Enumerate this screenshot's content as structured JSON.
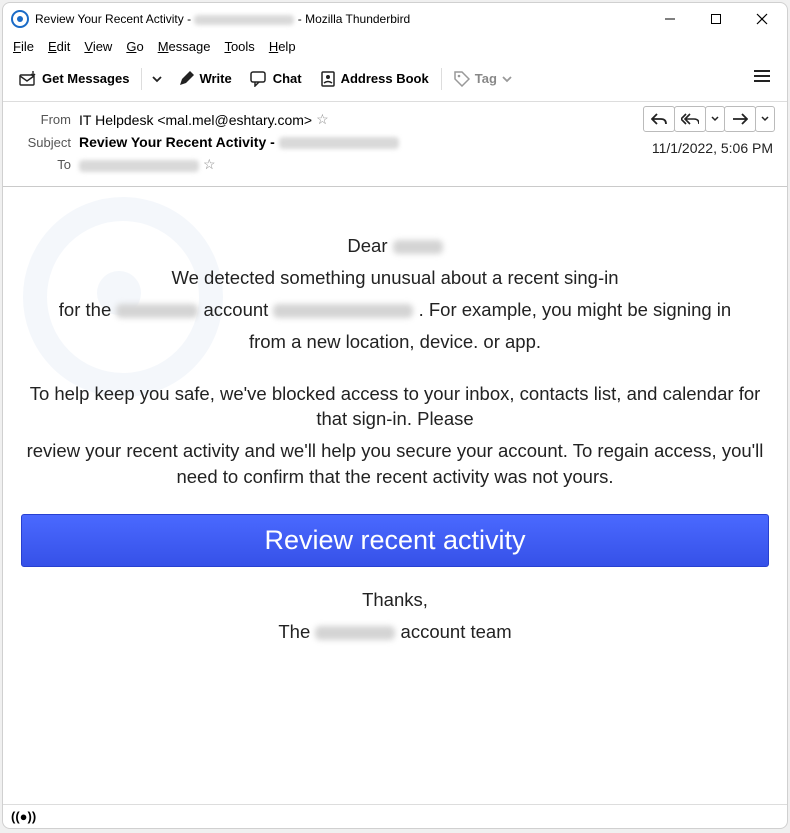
{
  "window": {
    "title_prefix": "Review Your Recent Activity - ",
    "title_suffix": " - Mozilla Thunderbird"
  },
  "menu": {
    "file": "File",
    "edit": "Edit",
    "view": "View",
    "go": "Go",
    "message": "Message",
    "tools": "Tools",
    "help": "Help"
  },
  "toolbar": {
    "get": "Get Messages",
    "write": "Write",
    "chat": "Chat",
    "abook": "Address Book",
    "tag": "Tag"
  },
  "headers": {
    "from_label": "From",
    "from_value": "IT Helpdesk <mal.mel@eshtary.com>",
    "subject_label": "Subject",
    "subject_value": "Review Your Recent Activity - ",
    "to_label": "To",
    "date": "11/1/2022, 5:06 PM"
  },
  "body": {
    "dear": "Dear ",
    "l1": "We detected something unusual about a recent sing-in",
    "l2a": "for the ",
    "l2b": " account ",
    "l2c": " . For example, you might be signing in",
    "l3": "from a new location, device. or app.",
    "l4": "To help keep you safe, we've blocked access to your inbox, contacts list, and calendar for that sign-in. Please",
    "l5": "review your recent activity and we'll help you secure your account. To regain access, you'll need to confirm that the recent activity was not yours.",
    "button": "Review recent activity",
    "thanks": "Thanks,",
    "team_a": "The ",
    "team_b": " account team"
  }
}
